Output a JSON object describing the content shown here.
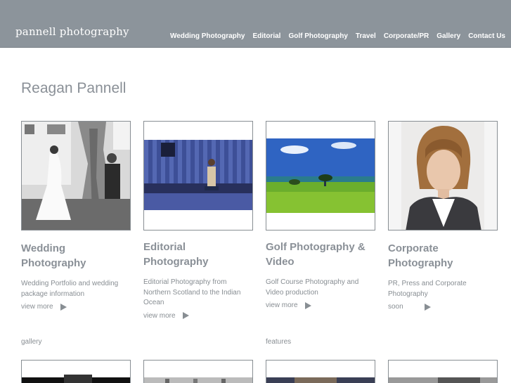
{
  "header": {
    "logo": "pannell photography",
    "nav": [
      "Wedding Photography",
      "Editorial",
      "Golf Photography",
      "Travel",
      "Corporate/PR",
      "Gallery",
      "Contact Us"
    ]
  },
  "page": {
    "title": "Reagan Pannell"
  },
  "cards": [
    {
      "caption_line1": "Wedding",
      "caption_line2": "Photography",
      "desc_line1": "Wedding Portfolio and wedding",
      "desc_line2": "package information",
      "desc_line3": "",
      "more": "view more",
      "tag": "gallery"
    },
    {
      "caption_line1": "Editorial",
      "caption_line2": "Photography",
      "desc_line1": "Editorial Photography from",
      "desc_line2": "Northern Scotland to the Indian",
      "desc_line3": "Ocean",
      "more": "view more",
      "tag": ""
    },
    {
      "caption_line1": "Golf Photography &",
      "caption_line2": "Video",
      "desc_line1": "Golf Course Photography and",
      "desc_line2": "Video production",
      "desc_line3": "",
      "more": "view more",
      "tag": "features"
    },
    {
      "caption_line1": "Corporate",
      "caption_line2": "Photography",
      "desc_line1": "PR, Press and Corporate",
      "desc_line2": "Photography",
      "desc_line3": "",
      "more": "soon",
      "tag": ""
    }
  ],
  "colors": {
    "header_bg": "#8c949b",
    "text_grey": "#888e93",
    "title_grey": "#8a9097"
  },
  "icons": {
    "more": "play-triangle-icon"
  }
}
